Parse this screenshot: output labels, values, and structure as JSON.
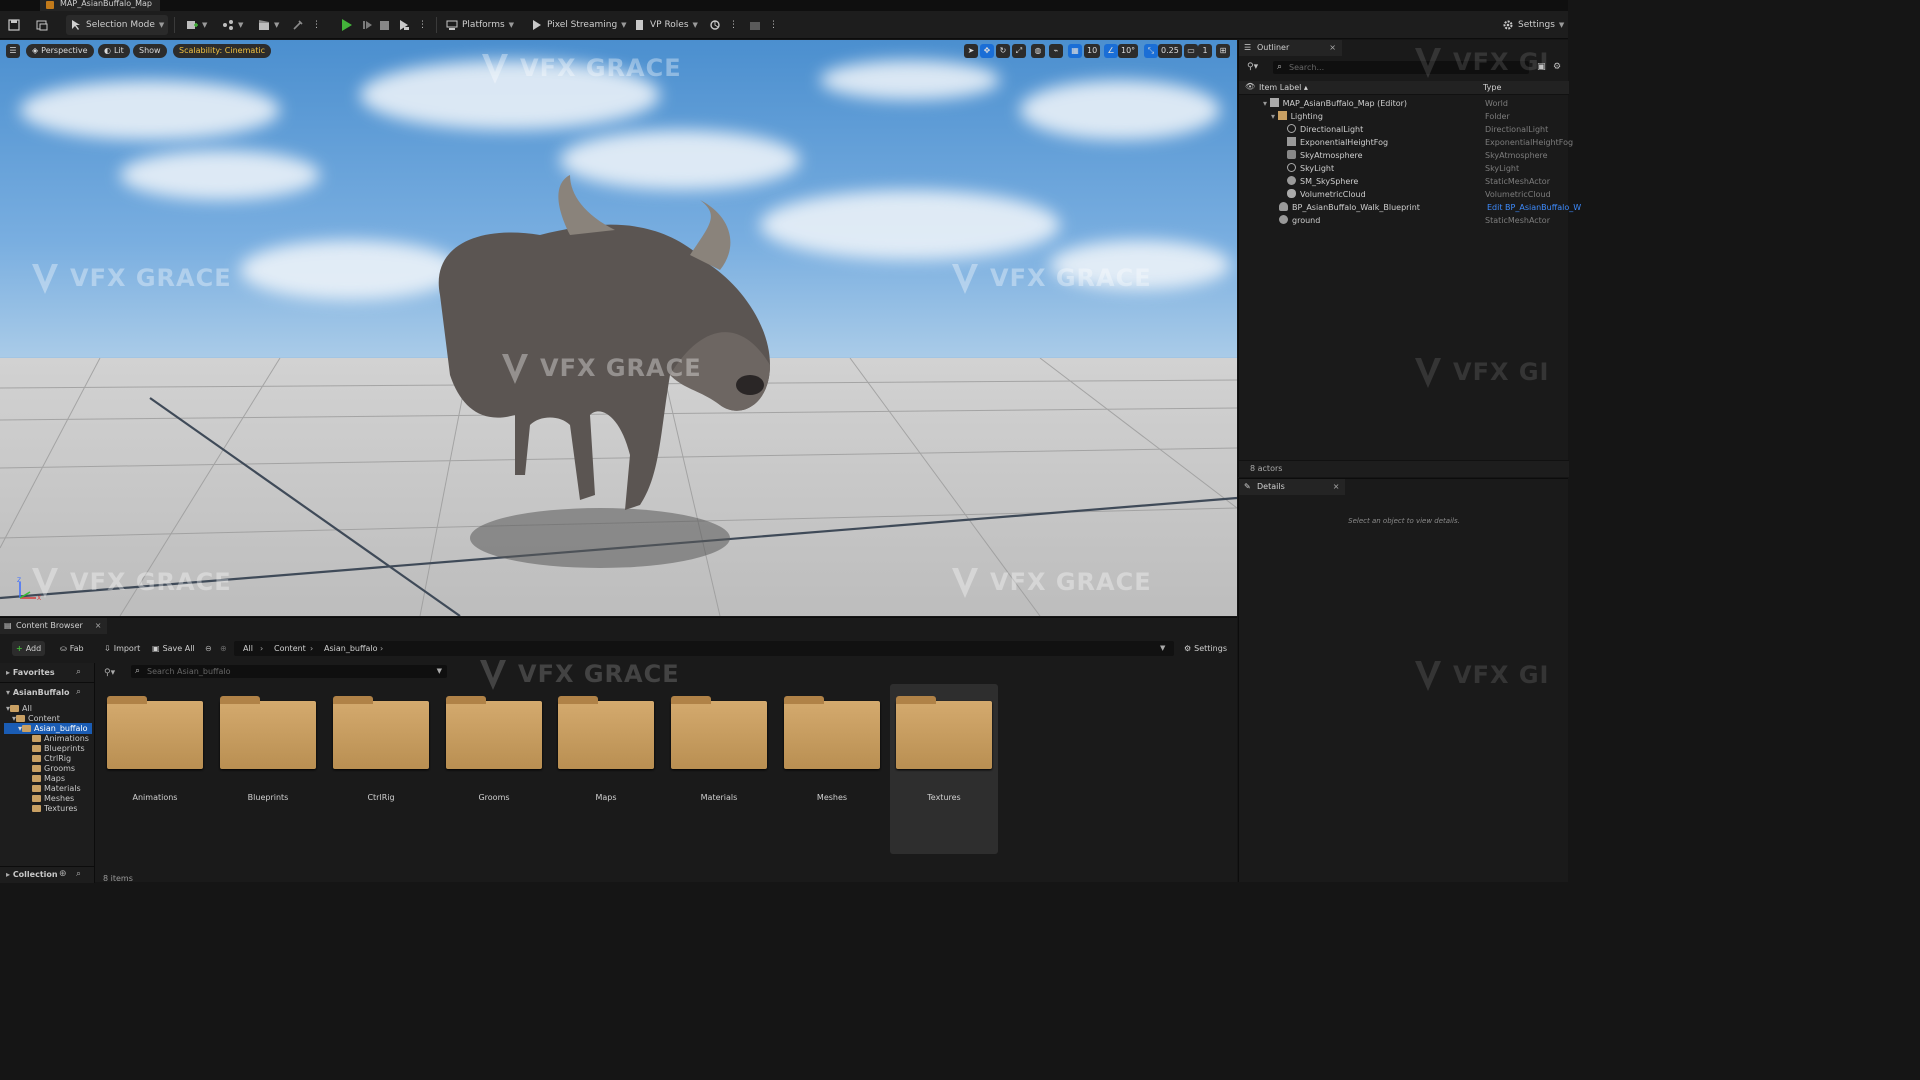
{
  "window": {
    "tab_title": "MAP_AsianBuffalo_Map"
  },
  "toolbar": {
    "selection_mode": "Selection Mode",
    "platforms": "Platforms",
    "pixel_streaming": "Pixel Streaming",
    "vp_roles": "VP Roles",
    "settings": "Settings"
  },
  "viewport": {
    "perspective": "Perspective",
    "lit": "Lit",
    "show": "Show",
    "scalability": "Scalability: Cinematic",
    "grid_snap": "10",
    "angle_snap": "10°",
    "scale_snap": "0.25",
    "camera_speed": "1",
    "watermark": "VFX GRACE",
    "axis_z": "Z",
    "axis_x": "X"
  },
  "outliner": {
    "tab_label": "Outliner",
    "search_placeholder": "Search...",
    "col_label": "Item Label",
    "col_type": "Type",
    "rows": [
      {
        "label": "MAP_AsianBuffalo_Map (Editor)",
        "type": "World"
      },
      {
        "label": "Lighting",
        "type": "Folder"
      },
      {
        "label": "DirectionalLight",
        "type": "DirectionalLight"
      },
      {
        "label": "ExponentialHeightFog",
        "type": "ExponentialHeightFog"
      },
      {
        "label": "SkyAtmosphere",
        "type": "SkyAtmosphere"
      },
      {
        "label": "SkyLight",
        "type": "SkyLight"
      },
      {
        "label": "SM_SkySphere",
        "type": "StaticMeshActor"
      },
      {
        "label": "VolumetricCloud",
        "type": "VolumetricCloud"
      },
      {
        "label": "BP_AsianBuffalo_Walk_Blueprint",
        "type": "Edit BP_AsianBuffalo_W"
      },
      {
        "label": "ground",
        "type": "StaticMeshActor"
      }
    ],
    "actor_count": "8 actors",
    "watermark": "VFX GI"
  },
  "details": {
    "tab_label": "Details",
    "empty_message": "Select an object to view details."
  },
  "content_browser": {
    "tab_label": "Content Browser",
    "add": "Add",
    "fab": "Fab",
    "import": "Import",
    "save_all": "Save All",
    "breadcrumb": [
      "All",
      "Content",
      "Asian_buffalo"
    ],
    "settings": "Settings",
    "search_placeholder": "Search Asian_buffalo",
    "favorites": "Favorites",
    "project": "AsianBuffalo",
    "tree": [
      "All",
      "Content",
      "Asian_buffalo",
      "Animations",
      "Blueprints",
      "CtrlRig",
      "Grooms",
      "Maps",
      "Materials",
      "Meshes",
      "Textures"
    ],
    "folders": [
      "Animations",
      "Blueprints",
      "CtrlRig",
      "Grooms",
      "Maps",
      "Materials",
      "Meshes",
      "Textures"
    ],
    "selected_folder": "Textures",
    "collection": "Collection",
    "item_count": "8 items"
  },
  "colors": {
    "accent_blue": "#1a6ed6",
    "folder": "#c9a063",
    "play_green": "#43b33a",
    "scalability_yellow": "#f0c040"
  }
}
